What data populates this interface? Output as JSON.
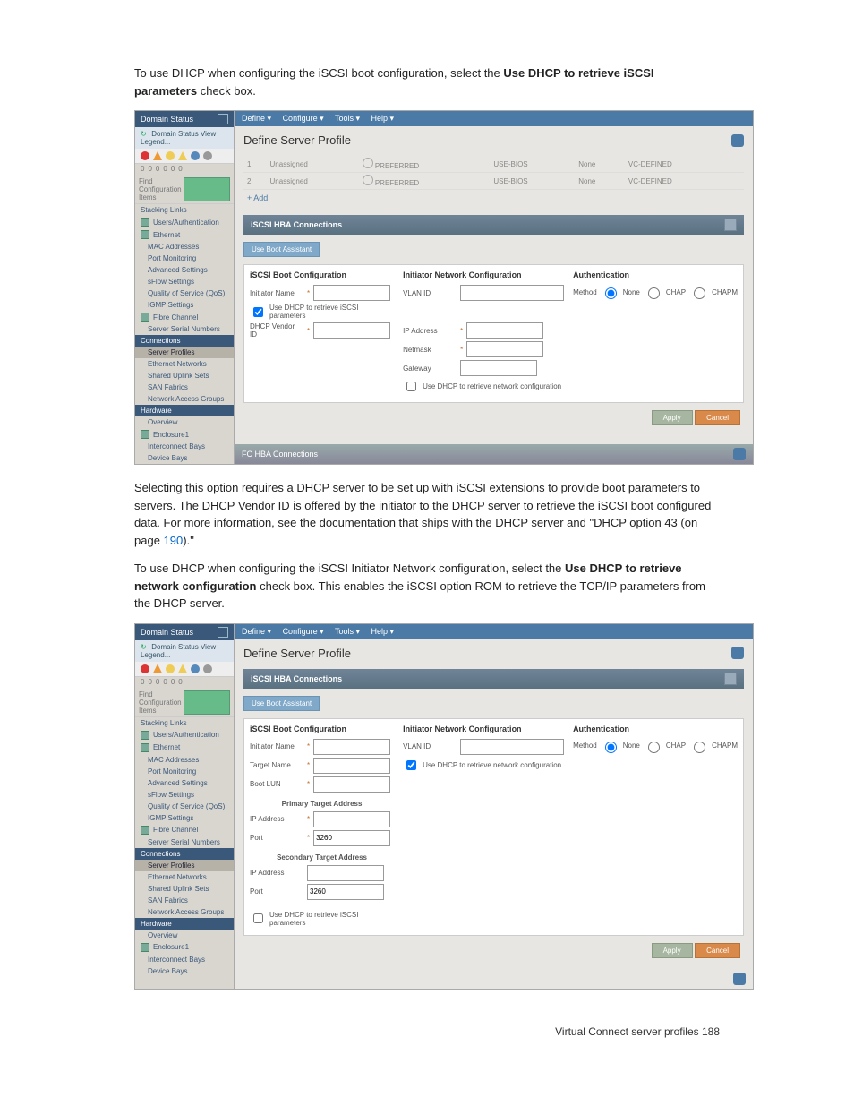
{
  "intro_p1_a": "To use DHCP when configuring the iSCSI boot configuration, select the ",
  "intro_p1_b": "Use DHCP to retrieve iSCSI parameters",
  "intro_p1_c": " check box.",
  "mid_p_a": "Selecting this option requires a DHCP server to be set up with iSCSI extensions to provide boot parameters to servers. The DHCP Vendor ID is offered by the initiator to the DHCP server to retrieve the iSCSI boot configured data. For more information, see the documentation that ships with the DHCP server and \"DHCP option 43 (on page ",
  "mid_p_link": "190",
  "mid_p_b": ").\"",
  "intro_p2_a": "To use DHCP when configuring the iSCSI Initiator Network configuration, select the ",
  "intro_p2_b": "Use DHCP to retrieve network configuration",
  "intro_p2_c": " check box. This enables the iSCSI option ROM to retrieve the TCP/IP parameters from the DHCP server.",
  "footer_text": "Virtual Connect server profiles    188",
  "ui": {
    "sidebar": {
      "domain_status": "Domain Status",
      "legend": "Domain Status   View Legend...",
      "status_nums": [
        "0",
        "0",
        "0",
        "0",
        "0",
        "0"
      ],
      "find": "Find Configuration Items",
      "items_top": [
        "Stacking Links",
        "Users/Authentication",
        "Ethernet"
      ],
      "items_eth": [
        "MAC Addresses",
        "Port Monitoring",
        "Advanced Settings",
        "sFlow Settings",
        "Quality of Service (QoS)",
        "IGMP Settings"
      ],
      "items_fc_head": "Fibre Channel",
      "items_fc": [
        "Server Serial Numbers"
      ],
      "conn_head": "Connections",
      "items_conn": [
        "Server Profiles",
        "Ethernet Networks",
        "Shared Uplink Sets",
        "SAN Fabrics",
        "Network Access Groups"
      ],
      "hw_head": "Hardware",
      "items_hw": [
        "Overview",
        "Enclosure1",
        "Interconnect Bays",
        "Device Bays"
      ]
    },
    "menus": [
      "Define ▾",
      "Configure ▾",
      "Tools ▾",
      "Help ▾"
    ],
    "page_title": "Define Server Profile",
    "conn_table": {
      "rows": [
        {
          "n": "1",
          "a": "Unassigned",
          "b": "PREFERRED",
          "c": "USE-BIOS",
          "d": "None",
          "e": "VC-DEFINED"
        },
        {
          "n": "2",
          "a": "Unassigned",
          "b": "PREFERRED",
          "c": "USE-BIOS",
          "d": "None",
          "e": "VC-DEFINED"
        }
      ],
      "add": "+ Add"
    },
    "hba_header": "iSCSI HBA Connections",
    "boot_assist": "Use Boot Assistant",
    "cols": {
      "boot": "iSCSI Boot Configuration",
      "net": "Initiator Network Configuration",
      "auth": "Authentication"
    },
    "fields1": {
      "initiator_name": "Initiator Name",
      "use_dhcp_iscsi": "Use DHCP to retrieve iSCSI parameters",
      "dhcp_vendor": "DHCP Vendor ID",
      "vlan": "VLAN ID",
      "ip": "IP Address",
      "netmask": "Netmask",
      "gateway": "Gateway",
      "use_dhcp_net": "Use DHCP to retrieve network configuration",
      "method": "Method",
      "none": "None",
      "chap": "CHAP",
      "chapm": "CHAPM"
    },
    "fields2": {
      "initiator_name": "Initiator Name",
      "target_name": "Target Name",
      "boot_lun": "Boot LUN",
      "primary": "Primary Target Address",
      "secondary": "Secondary Target Address",
      "ip": "IP Address",
      "port": "Port",
      "port_val": "3260",
      "use_dhcp_iscsi": "Use DHCP to retrieve iSCSI parameters",
      "vlan": "VLAN ID",
      "use_dhcp_net": "Use DHCP to retrieve network configuration"
    },
    "apply": "Apply",
    "cancel": "Cancel",
    "fc_hba": "FC HBA Connections"
  }
}
